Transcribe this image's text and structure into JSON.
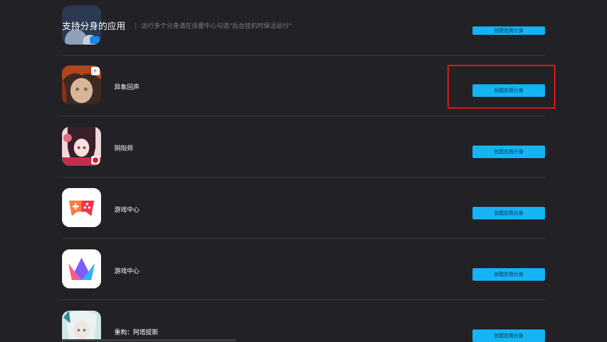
{
  "header": {
    "title": "支持分身的应用",
    "subtitle": "运行多个分身请在设置中心勾选\"后台挂机时保活运行\""
  },
  "apps": [
    {
      "name": "",
      "button_label": "创建应用分身",
      "icon": "anime-avatar-icon"
    },
    {
      "name": "异象回声",
      "button_label": "创建应用分身",
      "icon": "anime-girl-icon"
    },
    {
      "name": "阴阳师",
      "button_label": "创建应用分身",
      "icon": "onmyoji-icon"
    },
    {
      "name": "游戏中心",
      "button_label": "创建应用分身",
      "icon": "gamepad-icon"
    },
    {
      "name": "游戏中心",
      "button_label": "创建应用分身",
      "icon": "crown-icon"
    },
    {
      "name": "重构：阿塔提斯",
      "button_label": "创建应用分身",
      "icon": "anime-character-icon"
    }
  ],
  "colors": {
    "background": "#222226",
    "button": "#14b4f5",
    "highlight": "#e0161a"
  }
}
